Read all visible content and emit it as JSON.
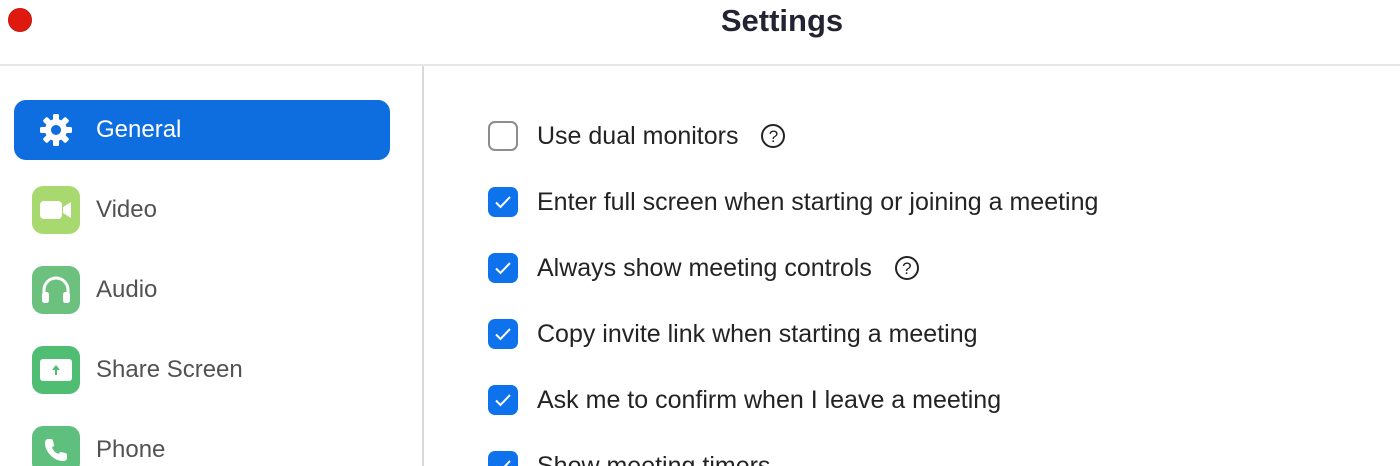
{
  "window": {
    "title": "Settings",
    "close_color": "#e0190f"
  },
  "colors": {
    "accent": "#0e6ee0",
    "checkbox": "#0e72ed",
    "video_icon": "#a8d96f",
    "audio_icon": "#6cc17f",
    "share_icon": "#4fbd72",
    "phone_icon": "#5fc07e"
  },
  "sidebar": {
    "items": [
      {
        "label": "General",
        "icon": "gear-icon",
        "active": true
      },
      {
        "label": "Video",
        "icon": "video-camera-icon",
        "active": false
      },
      {
        "label": "Audio",
        "icon": "headphones-icon",
        "active": false
      },
      {
        "label": "Share Screen",
        "icon": "share-screen-icon",
        "active": false
      },
      {
        "label": "Phone",
        "icon": "phone-icon",
        "active": false
      }
    ]
  },
  "general": {
    "help_glyph": "?",
    "options": [
      {
        "label": "Use dual monitors",
        "checked": false,
        "has_help": true
      },
      {
        "label": "Enter full screen when starting or joining a meeting",
        "checked": true,
        "has_help": false
      },
      {
        "label": "Always show meeting controls",
        "checked": true,
        "has_help": true
      },
      {
        "label": "Copy invite link when starting a meeting",
        "checked": true,
        "has_help": false
      },
      {
        "label": "Ask me to confirm when I leave a meeting",
        "checked": true,
        "has_help": false
      },
      {
        "label": "Show meeting timers",
        "checked": true,
        "has_help": false
      }
    ]
  }
}
